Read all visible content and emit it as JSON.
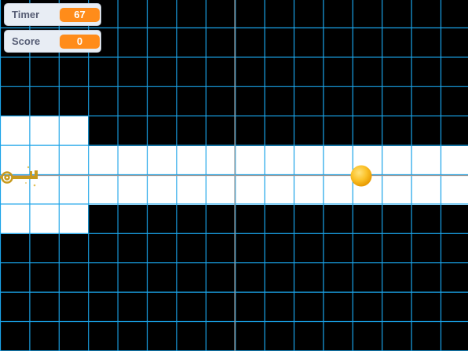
{
  "monitors": {
    "timer": {
      "label": "Timer",
      "value": "67"
    },
    "score": {
      "label": "Score",
      "value": "0"
    }
  },
  "colors": {
    "background": "#000000",
    "path": "#ffffff",
    "grid": "#1aa3e8",
    "axis": "#9a9a9a",
    "monitor_value": "#ff8c1a",
    "key": "#c79a1e",
    "ball": "#f7b500"
  },
  "sprites": {
    "key": {
      "icon": "key-icon"
    },
    "ball": {
      "icon": "ball-icon"
    }
  }
}
